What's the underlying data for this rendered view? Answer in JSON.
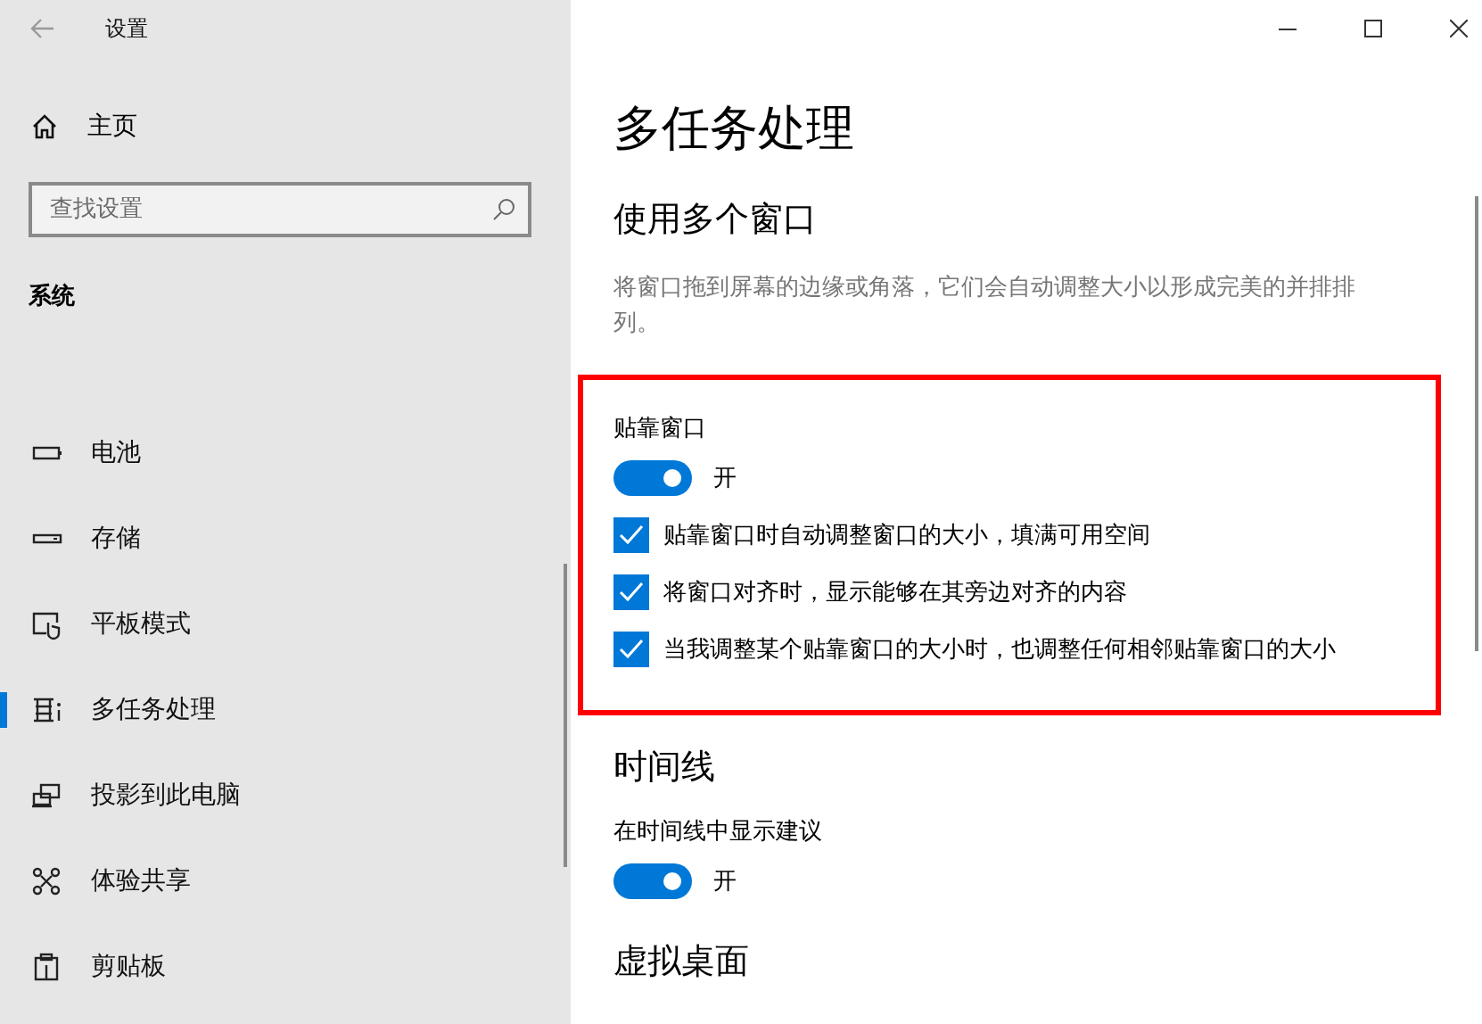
{
  "window": {
    "title": "设置"
  },
  "sidebar": {
    "home": "主页",
    "search": {
      "placeholder": "查找设置"
    },
    "section": "系统",
    "items": [
      {
        "label": "电池",
        "selected": false
      },
      {
        "label": "存储",
        "selected": false
      },
      {
        "label": "平板模式",
        "selected": false
      },
      {
        "label": "多任务处理",
        "selected": true
      },
      {
        "label": "投影到此电脑",
        "selected": false
      },
      {
        "label": "体验共享",
        "selected": false
      },
      {
        "label": "剪贴板",
        "selected": false
      }
    ]
  },
  "page": {
    "title": "多任务处理",
    "sections": [
      {
        "heading": "使用多个窗口",
        "description": "将窗口拖到屏幕的边缘或角落，它们会自动调整大小以形成完美的并排排列。",
        "highlighted": true,
        "settings": [
          {
            "kind": "toggle",
            "label": "贴靠窗口",
            "on": true,
            "state_label": "开"
          },
          {
            "kind": "checkbox",
            "label": "贴靠窗口时自动调整窗口的大小，填满可用空间",
            "checked": true
          },
          {
            "kind": "checkbox",
            "label": "将窗口对齐时，显示能够在其旁边对齐的内容",
            "checked": true
          },
          {
            "kind": "checkbox",
            "label": "当我调整某个贴靠窗口的大小时，也调整任何相邻贴靠窗口的大小",
            "checked": true
          }
        ]
      },
      {
        "heading": "时间线",
        "highlighted": false,
        "settings": [
          {
            "kind": "toggle",
            "label": "在时间线中显示建议",
            "on": true,
            "state_label": "开"
          }
        ]
      },
      {
        "heading": "虚拟桌面",
        "highlighted": false
      }
    ]
  }
}
